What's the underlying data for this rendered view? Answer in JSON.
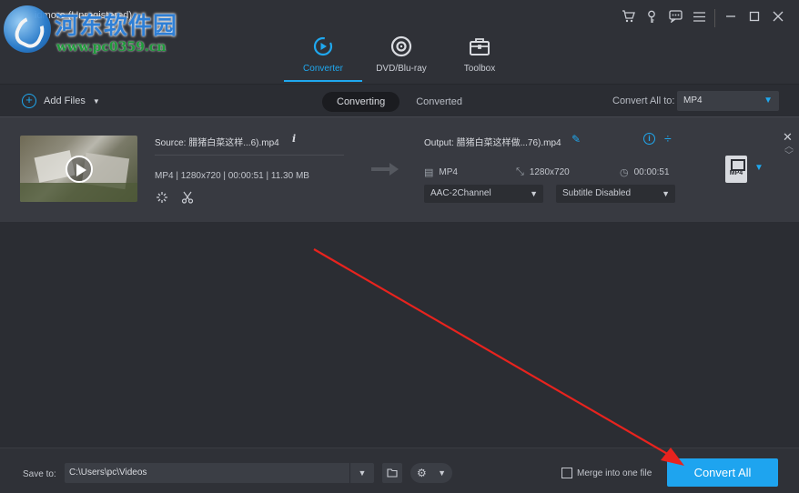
{
  "app": {
    "title": "idmore (Unregistered)",
    "watermark_name": "河东软件园",
    "watermark_url": "www.pc0359.cn"
  },
  "window_controls": [
    "cart-icon",
    "key-icon",
    "chat-icon",
    "menu-icon",
    "minimize-icon",
    "maximize-icon",
    "close-icon"
  ],
  "nav": {
    "items": [
      {
        "label": "Converter",
        "icon": "converter-icon",
        "active": true
      },
      {
        "label": "DVD/Blu-ray",
        "icon": "disc-icon",
        "active": false
      },
      {
        "label": "Toolbox",
        "icon": "toolbox-icon",
        "active": false
      }
    ]
  },
  "toolbar": {
    "add_files": "Add Files",
    "tabs": [
      {
        "label": "Converting",
        "active": true
      },
      {
        "label": "Converted",
        "active": false
      }
    ],
    "convert_all_to_label": "Convert All to:",
    "convert_all_to_value": "MP4"
  },
  "file": {
    "source": "Source: 腊猪白菜这样...6).mp4",
    "source_meta": "MP4 | 1280x720 | 00:00:51 | 11.30 MB",
    "output": "Output: 腊猪白菜这样做...76).mp4",
    "out_format": "MP4",
    "out_resolution": "1280x720",
    "out_duration": "00:00:51",
    "audio_track": "AAC-2Channel",
    "subtitle": "Subtitle Disabled",
    "format_badge": "MP4"
  },
  "bottom": {
    "save_to_label": "Save to:",
    "save_path": "C:\\Users\\pc\\Videos",
    "merge_label": "Merge into one file",
    "convert_all": "Convert All"
  },
  "colors": {
    "accent": "#1fa8ef",
    "convert_button": "#1ea4ef",
    "annotation_arrow": "#e8231e"
  }
}
